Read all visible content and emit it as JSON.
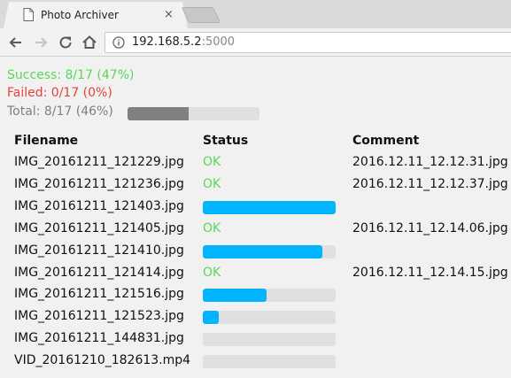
{
  "browser": {
    "tab": {
      "title": "Photo Archiver",
      "close_glyph": "×",
      "favicon": "page-icon"
    },
    "toolbar": {
      "icons": [
        "back-arrow-icon",
        "forward-arrow-icon",
        "reload-icon",
        "home-icon"
      ],
      "info_icon": "info-icon"
    },
    "url": {
      "host": "192.168.5.2",
      "port": ":5000"
    }
  },
  "summary": {
    "success": "Success:  8/17 (47%)",
    "failed": "Failed:  0/17 (0%)",
    "total": "Total:  8/17 (46%)",
    "total_progress": 0.46
  },
  "table": {
    "headers": {
      "filename": "Filename",
      "status": "Status",
      "comment": "Comment"
    },
    "rows": [
      {
        "filename": "IMG_20161211_121229.jpg",
        "status": "OK",
        "comment": "2016.12.11_12.12.31.jpg"
      },
      {
        "filename": "IMG_20161211_121236.jpg",
        "status": "OK",
        "comment": "2016.12.11_12.12.37.jpg"
      },
      {
        "filename": "IMG_20161211_121403.jpg",
        "progress": 1.0,
        "comment": ""
      },
      {
        "filename": "IMG_20161211_121405.jpg",
        "status": "OK",
        "comment": "2016.12.11_12.14.06.jpg"
      },
      {
        "filename": "IMG_20161211_121410.jpg",
        "progress": 0.9,
        "comment": ""
      },
      {
        "filename": "IMG_20161211_121414.jpg",
        "status": "OK",
        "comment": "2016.12.11_12.14.15.jpg"
      },
      {
        "filename": "IMG_20161211_121516.jpg",
        "progress": 0.48,
        "comment": ""
      },
      {
        "filename": "IMG_20161211_121523.jpg",
        "progress": 0.12,
        "comment": ""
      },
      {
        "filename": "IMG_20161211_144831.jpg",
        "progress": 0.0,
        "comment": ""
      },
      {
        "filename": "VID_20161210_182613.mp4",
        "progress": 0.0,
        "comment": ""
      }
    ]
  },
  "colors": {
    "success": "#5cd65c",
    "failed": "#e8403a",
    "total": "#808080",
    "progress_fill": "#00b4ff",
    "progress_track": "#e0e0e0"
  }
}
